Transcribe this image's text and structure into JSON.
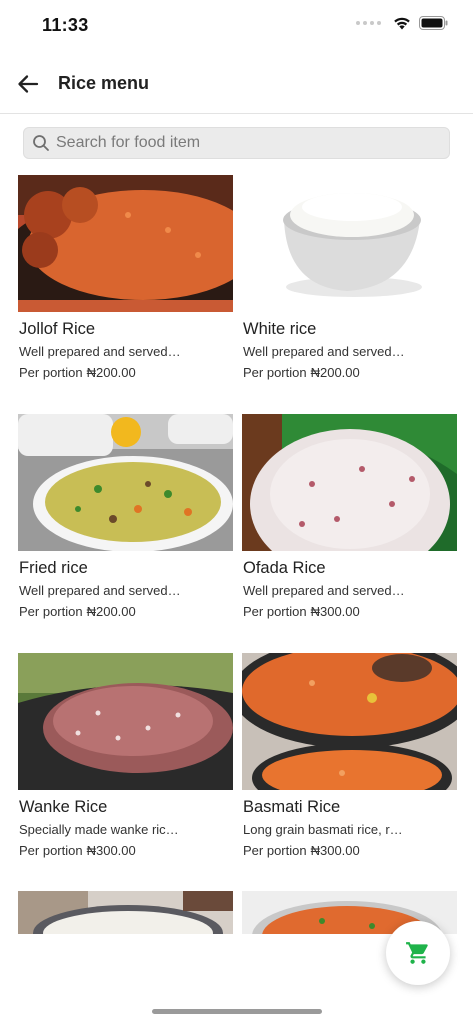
{
  "status_bar": {
    "time": "11:33"
  },
  "header": {
    "title": "Rice menu",
    "back_icon": "arrow-left-icon"
  },
  "search": {
    "placeholder": "Search for food item",
    "value": ""
  },
  "items": [
    {
      "name": "Jollof Rice",
      "description": "Well prepared and served…",
      "price_label": "Per portion",
      "price": "₦200.00"
    },
    {
      "name": "White rice",
      "description": "Well prepared and served…",
      "price_label": "Per portion",
      "price": "₦200.00"
    },
    {
      "name": "Fried rice",
      "description": "Well prepared and served…",
      "price_label": "Per portion",
      "price": "₦200.00"
    },
    {
      "name": "Ofada Rice",
      "description": "Well prepared and served…",
      "price_label": "Per portion",
      "price": "₦300.00"
    },
    {
      "name": "Wanke Rice",
      "description": "Specially made wanke ric…",
      "price_label": "Per portion",
      "price": "₦300.00"
    },
    {
      "name": "Basmati Rice",
      "description": "Long grain basmati rice, r…",
      "price_label": "Per portion",
      "price": "₦300.00"
    }
  ],
  "cart": {
    "icon": "shopping-cart-icon",
    "accent_color": "#1fb34a"
  }
}
